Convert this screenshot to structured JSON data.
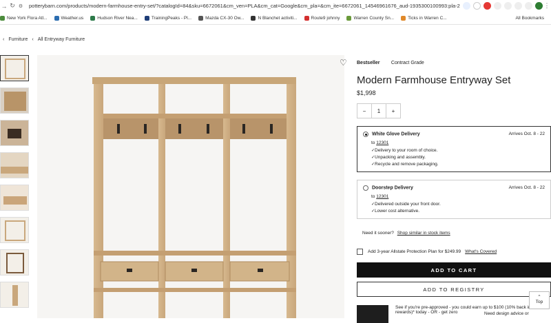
{
  "browser": {
    "url": "potterybarn.com/products/modern-farmhouse-entry-set/?catalogId=84&sku=6672061&cm_ven=PLA&cm_cat=Google&cm_pla=&cm_ite=6672061_14546961676_aud-1935300100993:pla-2963036...",
    "bookmarks": [
      {
        "label": "New York Flora Atl...",
        "color": "#4c8c3c"
      },
      {
        "label": "Weather.us",
        "color": "#2c6db0"
      },
      {
        "label": "Hudson River Nea...",
        "color": "#2d7a4a"
      },
      {
        "label": "TrainingPeaks - Pl...",
        "color": "#1f3e78"
      },
      {
        "label": "Mazda CX-30 Ow...",
        "color": "#555555"
      },
      {
        "label": "N Blanchet activiti...",
        "color": "#333333"
      },
      {
        "label": "Route9 johnny",
        "color": "#d32f2f"
      },
      {
        "label": "Warren County Sn...",
        "color": "#6a9a3a"
      },
      {
        "label": "Ticks in Warren C...",
        "color": "#e0892a"
      }
    ],
    "all_bookmarks": "All Bookmarks"
  },
  "breadcrumb": {
    "first": "Furniture",
    "second": "All Entryway Furniture"
  },
  "product": {
    "badge1": "Bestseller",
    "badge2": "Contract Grade",
    "title": "Modern Farmhouse Entryway Set",
    "price": "$1,998",
    "qty_minus": "−",
    "qty_value": "1",
    "qty_plus": "+"
  },
  "delivery": {
    "white_glove": {
      "title": "White Glove Delivery",
      "arrives": "Arrives Oct. 8 - 22",
      "to": "to",
      "zip": "12301",
      "bullets": [
        "Delivery to your room of choice.",
        "Unpacking and assembly.",
        "Recycle and remove packaging."
      ]
    },
    "doorstep": {
      "title": "Doorstep Delivery",
      "arrives": "Arrives Oct. 8 - 22",
      "to": "to",
      "zip": "12301",
      "bullets": [
        "Delivered outside your front door.",
        "Lower cost alternative."
      ]
    }
  },
  "sooner": {
    "text": "Need it sooner?",
    "link": "Shop similar in stock items"
  },
  "protection": {
    "text": "Add 3-year Allstate Protection Plan for $249.99",
    "link": "What's Covered"
  },
  "buttons": {
    "cart": "ADD TO CART",
    "registry": "ADD TO REGISTRY"
  },
  "promo": {
    "text": "See if you're pre-approved - you could earn up to $100 (10% back in rewards)* today - OR - get zero"
  },
  "top_button": "Top",
  "help": "Need design advice or"
}
